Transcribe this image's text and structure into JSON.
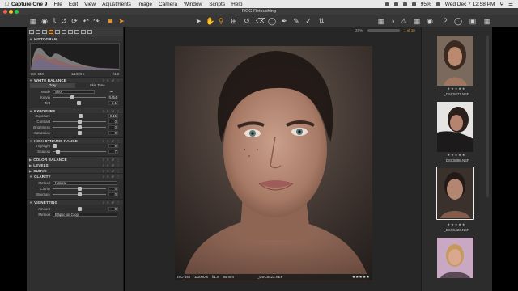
{
  "menubar": {
    "app": "Capture One 9",
    "items": [
      "File",
      "Edit",
      "View",
      "Adjustments",
      "Image",
      "Camera",
      "Window",
      "Scripts",
      "Help"
    ],
    "battery": "95%",
    "clock": "Wed Dec 7  12:58 PM"
  },
  "window": {
    "title": "RGG Retouching"
  },
  "viewer": {
    "zoom": "25%",
    "counter": "1 of 10"
  },
  "sidebar": {
    "histogram": {
      "title": "HISTOGRAM",
      "iso": "ISO 640",
      "shutter": "1/1000 s",
      "aperture": "f/1.8"
    },
    "white_balance": {
      "title": "WHITE BALANCE",
      "tabs": [
        "Gray",
        "Skin Tone"
      ],
      "mode_label": "Mode",
      "mode_value": "Shot",
      "kelvin_label": "Kelvin",
      "kelvin_value": "5454",
      "kelvin_level": 0.36,
      "tint_label": "Tint",
      "tint_value": "-2.1",
      "tint_level": 0.49
    },
    "exposure": {
      "title": "EXPOSURE",
      "rows": [
        {
          "label": "Exposure",
          "value": "0.15",
          "level": 0.52
        },
        {
          "label": "Contrast",
          "value": "0",
          "level": 0.5
        },
        {
          "label": "Brightness",
          "value": "0",
          "level": 0.5
        },
        {
          "label": "Saturation",
          "value": "0",
          "level": 0.5
        }
      ]
    },
    "hdr": {
      "title": "HIGH DYNAMIC RANGE",
      "rows": [
        {
          "label": "Highlight",
          "value": "0",
          "level": 0.0
        },
        {
          "label": "Shadow",
          "value": "7",
          "level": 0.07
        }
      ]
    },
    "collapsed": [
      "COLOR BALANCE",
      "LEVELS",
      "CURVE"
    ],
    "clarity": {
      "title": "CLARITY",
      "method_label": "Method",
      "method_value": "Natural",
      "rows": [
        {
          "label": "Clarity",
          "value": "0",
          "level": 0.5
        },
        {
          "label": "Structure",
          "value": "0",
          "level": 0.5
        }
      ]
    },
    "vignetting": {
      "title": "VIGNETTING",
      "amount_label": "Amount",
      "amount_value": "0",
      "amount_level": 0.5,
      "method_label": "Method",
      "method_value": "Elliptic on Crop"
    }
  },
  "photo_info": {
    "iso": "ISO 640",
    "shutter": "1/1000 s",
    "aperture": "f/1.8",
    "focal": "85 mm",
    "filename": "_DSC5423.NEF",
    "stars": "★★★★★"
  },
  "browser": {
    "thumbs": [
      {
        "caption": "_DSC5871.NEF",
        "stars": "★★★★★"
      },
      {
        "caption": "_DSC5888.NEF",
        "stars": "★★★★★"
      },
      {
        "caption": "_DSC5423.NEF",
        "stars": "★★★★★"
      },
      {
        "caption": "",
        "stars": ""
      }
    ]
  }
}
